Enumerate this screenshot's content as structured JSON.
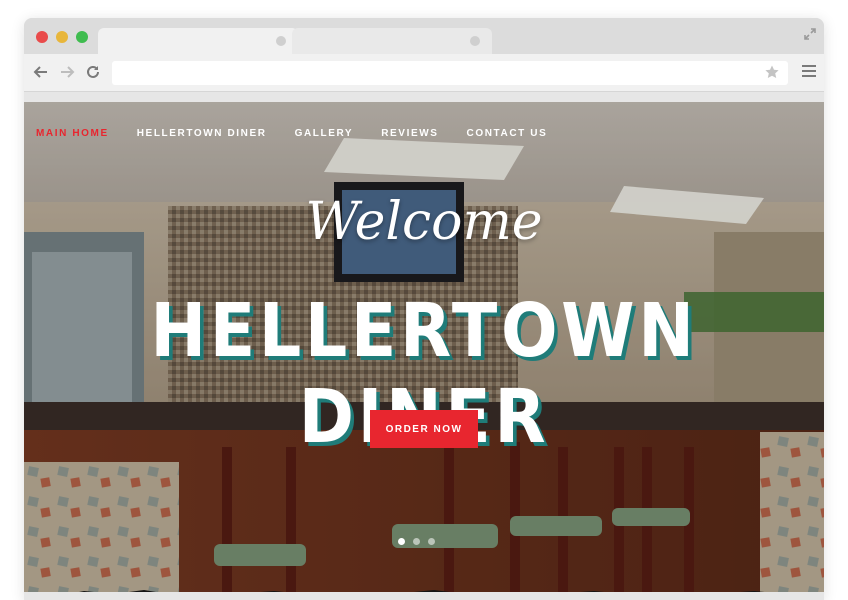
{
  "browser": {
    "url": "",
    "tabs": [
      {
        "title": ""
      },
      {
        "title": ""
      }
    ]
  },
  "nav": {
    "items": [
      {
        "label": "MAIN HOME",
        "active": true
      },
      {
        "label": "HELLERTOWN DINER",
        "active": false
      },
      {
        "label": "GALLERY",
        "active": false
      },
      {
        "label": "REVIEWS",
        "active": false
      },
      {
        "label": "CONTACT US",
        "active": false
      }
    ]
  },
  "hero": {
    "welcome": "Welcome",
    "title": "HELLERTOWN DINER",
    "cta_label": "ORDER NOW",
    "slides_total": 3,
    "slide_active": 1
  },
  "colors": {
    "accent_red": "#e8262f",
    "title_shadow_teal": "#1f7c79"
  }
}
